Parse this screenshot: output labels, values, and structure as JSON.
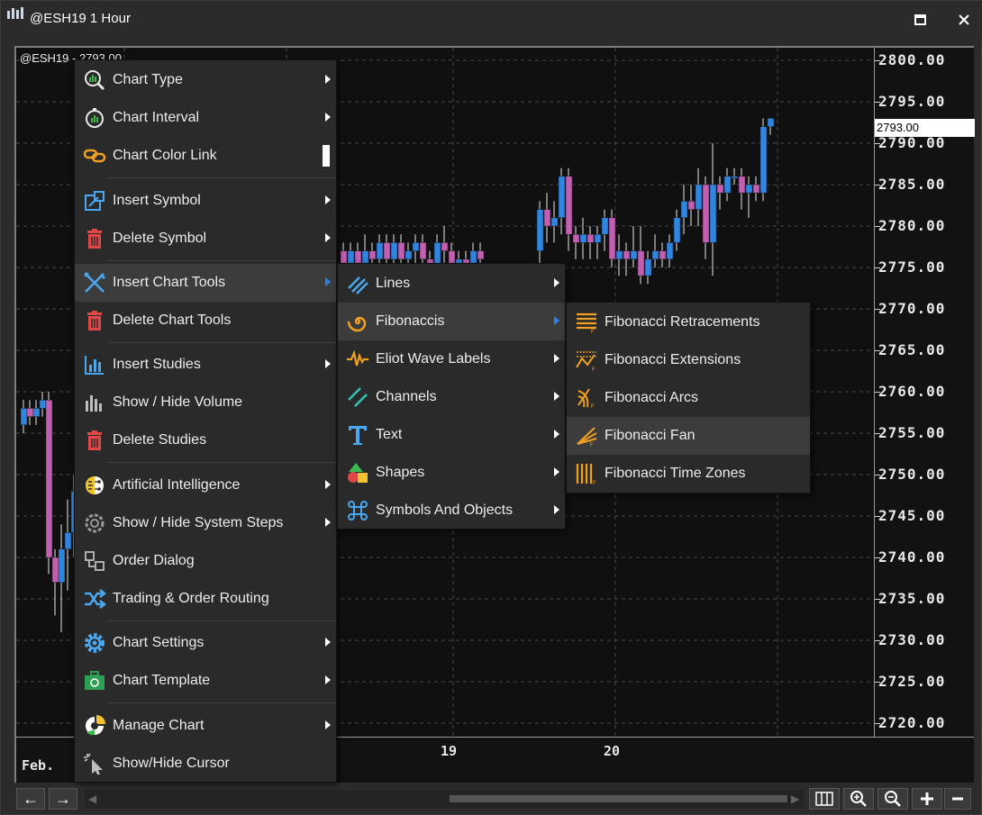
{
  "window": {
    "title": "@ESH19 1 Hour",
    "maximize_icon": "maximize-icon",
    "close_icon": "close-icon"
  },
  "chart": {
    "symbol_label": "@ESH19 - 2793.00",
    "last_price_flag": "2793.00",
    "price_ticks": [
      "2800.00",
      "2795.00",
      "2790.00",
      "2785.00",
      "2780.00",
      "2775.00",
      "2770.00",
      "2765.00",
      "2760.00",
      "2755.00",
      "2750.00",
      "2745.00",
      "2740.00",
      "2735.00",
      "2730.00",
      "2725.00",
      "2720.00"
    ],
    "time_labels": [
      "Feb.",
      "19",
      "20"
    ],
    "colors": {
      "up": "#2f86e0",
      "down": "#c25fb0",
      "wick": "#e8e8e8",
      "grid": "#4a4a4a"
    }
  },
  "context_menu": {
    "items": [
      {
        "label": "Chart Type",
        "icon": "chart-type-icon",
        "submenu": true
      },
      {
        "label": "Chart Interval",
        "icon": "stopwatch-icon",
        "submenu": true
      },
      {
        "label": "Chart Color Link",
        "icon": "link-icon",
        "submenu": false
      },
      {
        "label": "Insert Symbol",
        "icon": "insert-symbol-icon",
        "submenu": true
      },
      {
        "label": "Delete Symbol",
        "icon": "trash-icon",
        "submenu": true
      },
      {
        "label": "Insert Chart Tools",
        "icon": "chart-tools-icon",
        "submenu": true
      },
      {
        "label": "Delete Chart Tools",
        "icon": "trash-icon",
        "submenu": false
      },
      {
        "label": "Insert Studies",
        "icon": "studies-icon",
        "submenu": true
      },
      {
        "label": "Show / Hide Volume",
        "icon": "volume-icon",
        "submenu": false
      },
      {
        "label": "Delete Studies",
        "icon": "trash-icon",
        "submenu": false
      },
      {
        "label": "Artificial Intelligence",
        "icon": "brain-icon",
        "submenu": true
      },
      {
        "label": "Show / Hide System Steps",
        "icon": "system-steps-icon",
        "submenu": true
      },
      {
        "label": "Order Dialog",
        "icon": "order-dialog-icon",
        "submenu": false
      },
      {
        "label": "Trading & Order Routing",
        "icon": "routing-icon",
        "submenu": false
      },
      {
        "label": "Chart Settings",
        "icon": "gear-icon",
        "submenu": true
      },
      {
        "label": "Chart Template",
        "icon": "template-icon",
        "submenu": true
      },
      {
        "label": "Manage Chart",
        "icon": "manage-chart-icon",
        "submenu": true
      },
      {
        "label": "Show/Hide Cursor",
        "icon": "cursor-icon",
        "submenu": false
      }
    ]
  },
  "chart_tools_menu": {
    "items": [
      {
        "label": "Lines",
        "icon": "lines-icon"
      },
      {
        "label": "Fibonaccis",
        "icon": "fibonacci-icon"
      },
      {
        "label": "Eliot Wave Labels",
        "icon": "wave-icon"
      },
      {
        "label": "Channels",
        "icon": "channels-icon"
      },
      {
        "label": "Text",
        "icon": "text-icon"
      },
      {
        "label": "Shapes",
        "icon": "shapes-icon"
      },
      {
        "label": "Symbols And Objects",
        "icon": "symbols-icon"
      }
    ]
  },
  "fibonacci_menu": {
    "items": [
      {
        "label": "Fibonacci Retracements",
        "icon": "fib-retracement-icon"
      },
      {
        "label": "Fibonacci Extensions",
        "icon": "fib-extension-icon"
      },
      {
        "label": "Fibonacci Arcs",
        "icon": "fib-arcs-icon"
      },
      {
        "label": "Fibonacci Fan",
        "icon": "fib-fan-icon"
      },
      {
        "label": "Fibonacci Time Zones",
        "icon": "fib-timezones-icon"
      }
    ]
  },
  "bottom_bar": {
    "left_arrow": "←",
    "right_arrow": "→",
    "tools": [
      "columns-icon",
      "zoom-in-icon",
      "zoom-out-icon",
      "add-icon",
      "remove-icon"
    ]
  }
}
